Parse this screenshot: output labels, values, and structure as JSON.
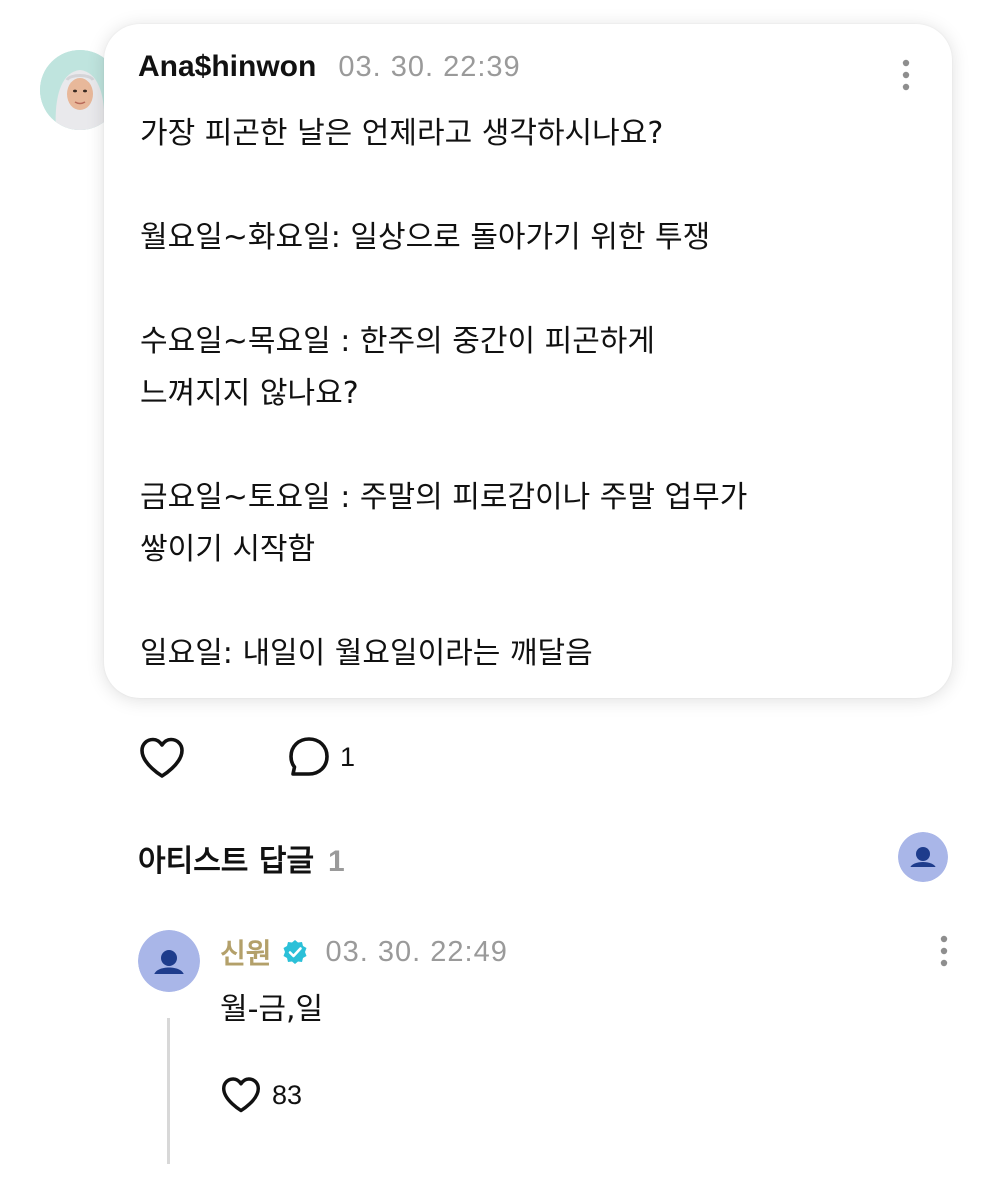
{
  "post": {
    "author": "Ana$hinwon",
    "timestamp": "03. 30. 22:39",
    "paragraphs": [
      "가장 피곤한 날은 언제라고 생각하시나요?",
      "월요일~화요일: 일상으로 돌아가기 위한 투쟁",
      "수요일~목요일 : 한주의 중간이 피곤하게\n느껴지지 않나요?",
      "금요일~토요일 : 주말의 피로감이나 주말 업무가\n쌓이기 시작함",
      "일요일: 내일이 월요일이라는 깨달음"
    ]
  },
  "actions": {
    "like_icon": "heart-outline-icon",
    "comment_icon": "speech-bubble-icon",
    "comment_count": "1"
  },
  "artist_replies": {
    "title": "아티스트 답글",
    "count": "1"
  },
  "reply": {
    "author": "신원",
    "verified": true,
    "timestamp": "03. 30. 22:49",
    "text": "월-금,일",
    "like_count": "83"
  },
  "colors": {
    "artist_name": "#b3a06a",
    "verified_badge": "#2bc0d8",
    "default_avatar": "#a9b6e8",
    "muted_text": "#9a9a9a"
  }
}
